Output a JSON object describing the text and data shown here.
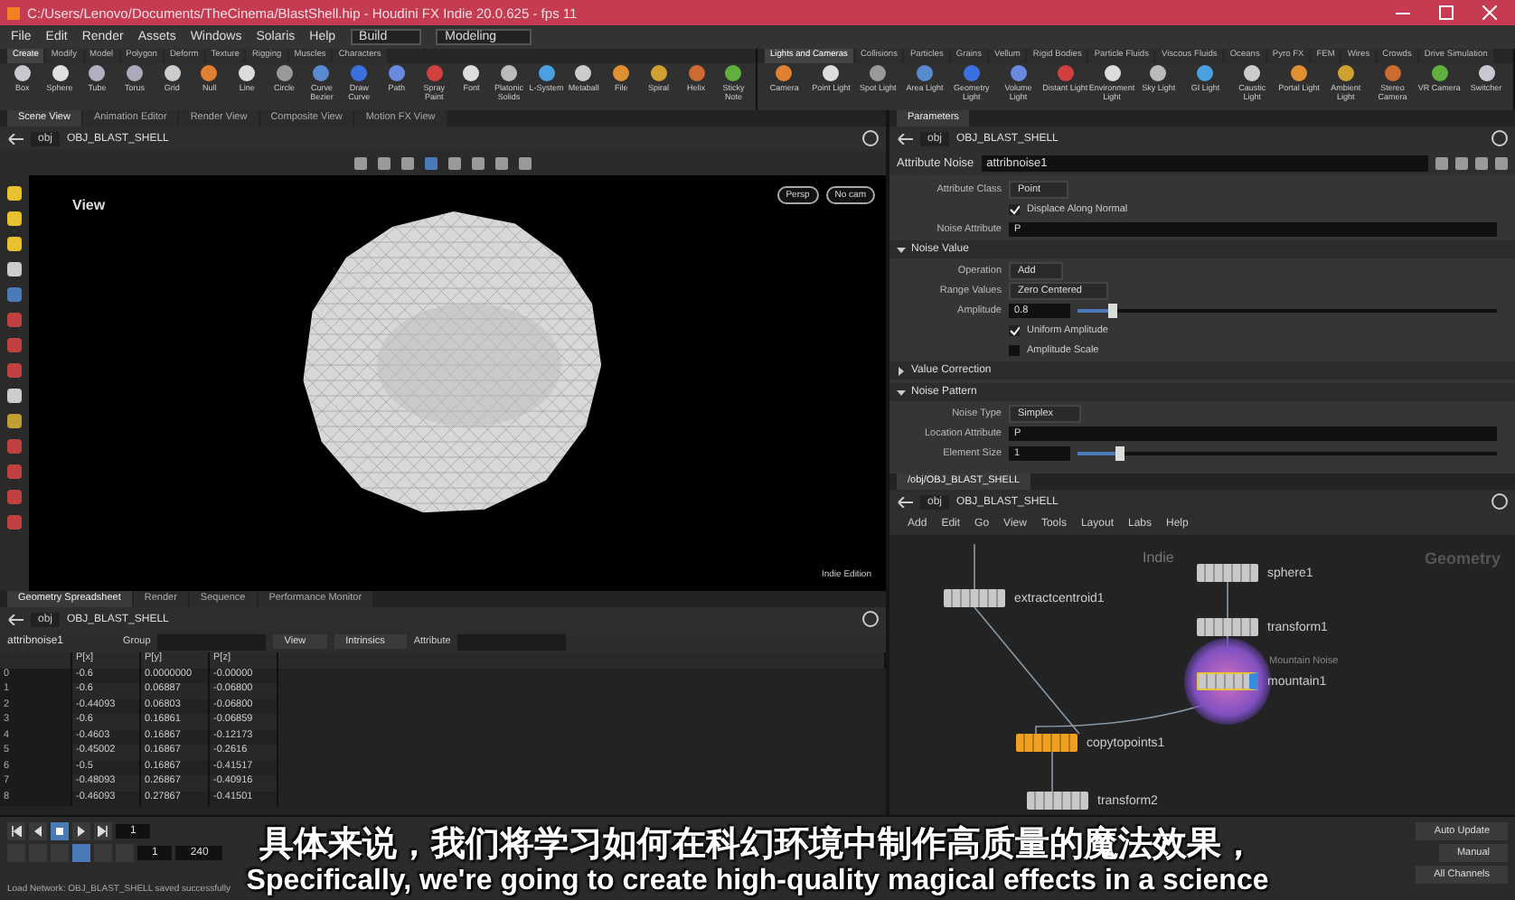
{
  "title_bar": {
    "title": "C:/Users/Lenovo/Documents/TheCinema/BlastShell.hip - Houdini FX Indie 20.0.625 - fps 11"
  },
  "menu": [
    "File",
    "Edit",
    "Render",
    "Assets",
    "Windows",
    "Solaris",
    "Help"
  ],
  "desktop": "Build",
  "context": "Modeling",
  "shelf_left": {
    "tabs": [
      {
        "label": "Create",
        "selected": true
      },
      {
        "label": "Modify",
        "selected": false
      },
      {
        "label": "Model",
        "selected": false
      },
      {
        "label": "Polygon",
        "selected": false
      },
      {
        "label": "Deform",
        "selected": false
      },
      {
        "label": "Texture",
        "selected": false
      },
      {
        "label": "Rigging",
        "selected": false
      },
      {
        "label": "Muscles",
        "selected": false
      },
      {
        "label": "Characters",
        "selected": false
      }
    ],
    "tools": [
      "Box",
      "Sphere",
      "Tube",
      "Torus",
      "Grid",
      "Null",
      "Line",
      "Circle",
      "Curve Bezier",
      "Draw Curve",
      "Path",
      "Spray Paint",
      "Font",
      "Platonic Solids",
      "L-System",
      "Metaball",
      "File",
      "Spiral",
      "Helix",
      "Sticky Note"
    ]
  },
  "shelf_right": {
    "tabs": [
      {
        "label": "Lights and Cameras",
        "selected": true
      },
      {
        "label": "Collisions",
        "selected": false
      },
      {
        "label": "Particles",
        "selected": false
      },
      {
        "label": "Grains",
        "selected": false
      },
      {
        "label": "Vellum",
        "selected": false
      },
      {
        "label": "Rigid Bodies",
        "selected": false
      },
      {
        "label": "Particle Fluids",
        "selected": false
      },
      {
        "label": "Viscous Fluids",
        "selected": false
      },
      {
        "label": "Oceans",
        "selected": false
      },
      {
        "label": "Pyro FX",
        "selected": false
      },
      {
        "label": "FEM",
        "selected": false
      },
      {
        "label": "Wires",
        "selected": false
      },
      {
        "label": "Crowds",
        "selected": false
      },
      {
        "label": "Drive Simulation",
        "selected": false
      }
    ],
    "tools": [
      "Camera",
      "Point Light",
      "Spot Light",
      "Area Light",
      "Geometry Light",
      "Volume Light",
      "Distant Light",
      "Environment Light",
      "Sky Light",
      "GI Light",
      "Caustic Light",
      "Portal Light",
      "Ambient Light",
      "Stereo Camera",
      "VR Camera",
      "Switcher"
    ]
  },
  "viewer": {
    "tabs": [
      {
        "label": "Scene View",
        "selected": true
      },
      {
        "label": "Animation Editor",
        "selected": false
      },
      {
        "label": "Render View",
        "selected": false
      },
      {
        "label": "Composite View",
        "selected": false
      },
      {
        "label": "Motion FX View",
        "selected": false
      }
    ],
    "path": {
      "context": "obj",
      "node": "OBJ_BLAST_SHELL"
    },
    "view_label": "View",
    "camera_menus": [
      "Persp",
      "No cam"
    ],
    "edition": "Indie Edition"
  },
  "parameters": {
    "tab": "Parameters",
    "path": {
      "context": "obj",
      "node": "OBJ_BLAST_SHELL"
    },
    "node_type": "Attribute Noise",
    "node_name": "attribnoise1",
    "rows": [
      {
        "kind": "menu",
        "label": "Attribute Class",
        "value": "Point"
      },
      {
        "kind": "check",
        "label": "Displace Along Normal",
        "checked": true
      },
      {
        "kind": "field",
        "label": "Noise Attribute",
        "value": "P"
      },
      {
        "kind": "section",
        "label": "Noise Value",
        "expanded": true
      },
      {
        "kind": "menu",
        "label": "Operation",
        "value": "Add"
      },
      {
        "kind": "menu",
        "label": "Range Values",
        "value": "Zero Centered"
      },
      {
        "kind": "slider",
        "label": "Amplitude",
        "value": "0.8",
        "level": 0.08
      },
      {
        "kind": "check",
        "label": "Uniform Amplitude",
        "checked": true
      },
      {
        "kind": "check",
        "label": "Amplitude Scale",
        "checked": false
      },
      {
        "kind": "section",
        "label": "Value Correction",
        "expanded": false
      },
      {
        "kind": "section",
        "label": "Noise Pattern",
        "expanded": true
      },
      {
        "kind": "menu",
        "label": "Noise Type",
        "value": "Simplex"
      },
      {
        "kind": "field",
        "label": "Location Attribute",
        "value": "P"
      },
      {
        "kind": "slider",
        "label": "Element Size",
        "value": "1",
        "level": 0.1
      }
    ]
  },
  "network": {
    "tab": "/obj/OBJ_BLAST_SHELL",
    "path": {
      "context": "obj",
      "node": "OBJ_BLAST_SHELL"
    },
    "menu": [
      "Add",
      "Edit",
      "Go",
      "View",
      "Tools",
      "Layout",
      "Labs",
      "Help"
    ],
    "context_label": "Geometry",
    "indie_label": "Indie",
    "nodes": [
      {
        "name": "extractcentroid1",
        "selected": false,
        "color": "#c8c8c8"
      },
      {
        "name": "sphere1",
        "selected": false,
        "color": "#c8c8c8"
      },
      {
        "name": "transform1",
        "selected": false,
        "color": "#c8c8c8"
      },
      {
        "name": "mountain1",
        "comment": "Mountain Noise",
        "selected": true,
        "color": "#c8c8c8"
      },
      {
        "name": "copytopoints1",
        "selected": false,
        "color": "#f0a020"
      },
      {
        "name": "transform2",
        "selected": false,
        "color": "#c8c8c8"
      }
    ]
  },
  "spreadsheet": {
    "tabs": [
      {
        "label": "Geometry Spreadsheet",
        "selected": true
      },
      {
        "label": "Render",
        "selected": false
      },
      {
        "label": "Sequence",
        "selected": false
      },
      {
        "label": "Performance Monitor",
        "selected": false
      }
    ],
    "path": {
      "context": "obj",
      "node": "OBJ_BLAST_SHELL"
    },
    "node": "attribnoise1",
    "group_label": "Group",
    "view_menu": "View",
    "intrinsics": "Intrinsics",
    "attribute_label": "Attribute",
    "columns": [
      "P[x]",
      "P[y]",
      "P[z]"
    ],
    "rows": [
      {
        "index": "0",
        "cells": [
          "-0.6",
          "0.0000000",
          "-0.00000"
        ]
      },
      {
        "index": "1",
        "cells": [
          "-0.6",
          "0.06887",
          "-0.06800"
        ]
      },
      {
        "index": "2",
        "cells": [
          "-0.44093",
          "0.06803",
          "-0.06800"
        ]
      },
      {
        "index": "3",
        "cells": [
          "-0.6",
          "0.16861",
          "-0.06859"
        ]
      },
      {
        "index": "4",
        "cells": [
          "-0.4603",
          "0.16867",
          "-0.12173"
        ]
      },
      {
        "index": "5",
        "cells": [
          "-0.45002",
          "0.16867",
          "-0.2616"
        ]
      },
      {
        "index": "6",
        "cells": [
          "-0.5",
          "0.16867",
          "-0.41517"
        ]
      },
      {
        "index": "7",
        "cells": [
          "-0.48093",
          "0.26867",
          "-0.40916"
        ]
      },
      {
        "index": "8",
        "cells": [
          "-0.46093",
          "0.27867",
          "-0.41501"
        ]
      }
    ]
  },
  "playbar": {
    "frame": "1",
    "start": "1",
    "end": "240"
  },
  "status_bar": "Load Network: OBJ_BLAST_SHELL saved successfully",
  "right_controls": [
    "Auto Update",
    "Manual",
    "All Channels"
  ],
  "subtitles": [
    "具体来说，我们将学习如何在科幻环境中制作高质量的魔法效果，",
    "Specifically, we're going to create high-quality magical effects in a science"
  ]
}
